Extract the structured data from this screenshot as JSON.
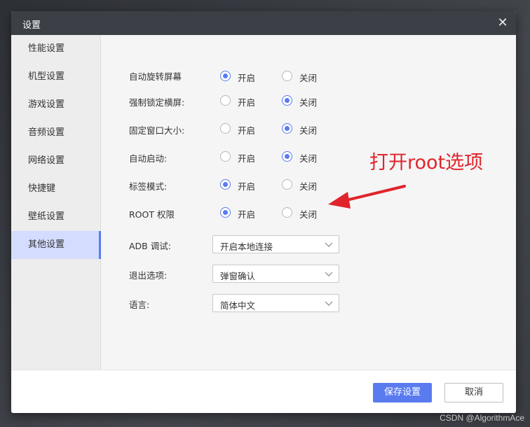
{
  "dialog": {
    "title": "设置",
    "close_glyph": "✕"
  },
  "sidebar": {
    "items": [
      {
        "label": "性能设置"
      },
      {
        "label": "机型设置"
      },
      {
        "label": "游戏设置"
      },
      {
        "label": "音频设置"
      },
      {
        "label": "网络设置"
      },
      {
        "label": "快捷键"
      },
      {
        "label": "壁纸设置"
      },
      {
        "label": "其他设置",
        "active": true
      }
    ]
  },
  "settings": {
    "options": {
      "on": "开启",
      "off": "关闭"
    },
    "radio_rows": [
      {
        "label": "自动旋转屏幕",
        "selected": "on"
      },
      {
        "label": "强制锁定横屏:",
        "selected": "off"
      },
      {
        "label": "固定窗口大小:",
        "selected": "off"
      },
      {
        "label": "自动启动:",
        "selected": "off"
      },
      {
        "label": "标签模式:",
        "selected": "on"
      },
      {
        "label": "ROOT 权限",
        "selected": "on"
      }
    ],
    "selects": [
      {
        "label": "ADB 调试:",
        "value": "开启本地连接"
      },
      {
        "label": "退出选项:",
        "value": "弹窗确认"
      },
      {
        "label": "语言:",
        "value": "简体中文"
      }
    ]
  },
  "footer": {
    "save_label": "保存设置",
    "cancel_label": "取消"
  },
  "annotation": {
    "text": "打开root选项",
    "color": "#e0242c"
  },
  "watermark": "CSDN @AlgorithmAce",
  "colors": {
    "accent": "#5a7bf0",
    "titlebar": "#3c3f46",
    "sidebar_active": "#d4dcff"
  }
}
